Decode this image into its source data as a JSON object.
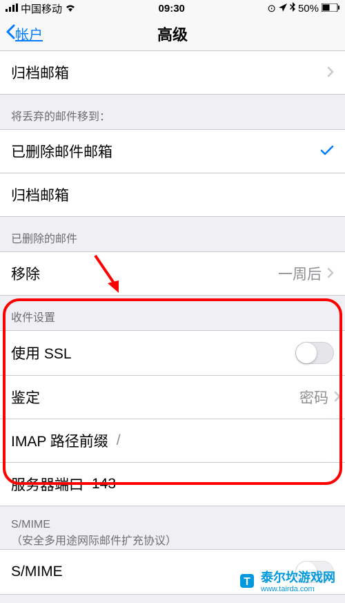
{
  "status": {
    "carrier": "中国移动",
    "time": "09:30",
    "battery": "50%"
  },
  "nav": {
    "back": "帐户",
    "title": "高级"
  },
  "section1": {
    "archive_mailbox": "归档邮箱"
  },
  "section_discard": {
    "header": "将丢弃的邮件移到：",
    "deleted_mailbox": "已删除邮件邮箱",
    "archive_mailbox": "归档邮箱"
  },
  "section_deleted": {
    "header": "已删除的邮件",
    "remove": "移除",
    "remove_value": "一周后"
  },
  "section_incoming": {
    "header": "收件设置",
    "use_ssl": "使用 SSL",
    "authentication": "鉴定",
    "authentication_value": "密码",
    "imap_prefix": "IMAP 路径前缀",
    "imap_prefix_value": "/",
    "server_port": "服务器端口",
    "server_port_value": "143"
  },
  "section_smime": {
    "header": "S/MIME",
    "subheader": "（安全多用途网际邮件扩充协议）",
    "smime": "S/MIME"
  },
  "watermark": {
    "name": "泰尔坎游戏网",
    "url": "www.tairda.com"
  }
}
